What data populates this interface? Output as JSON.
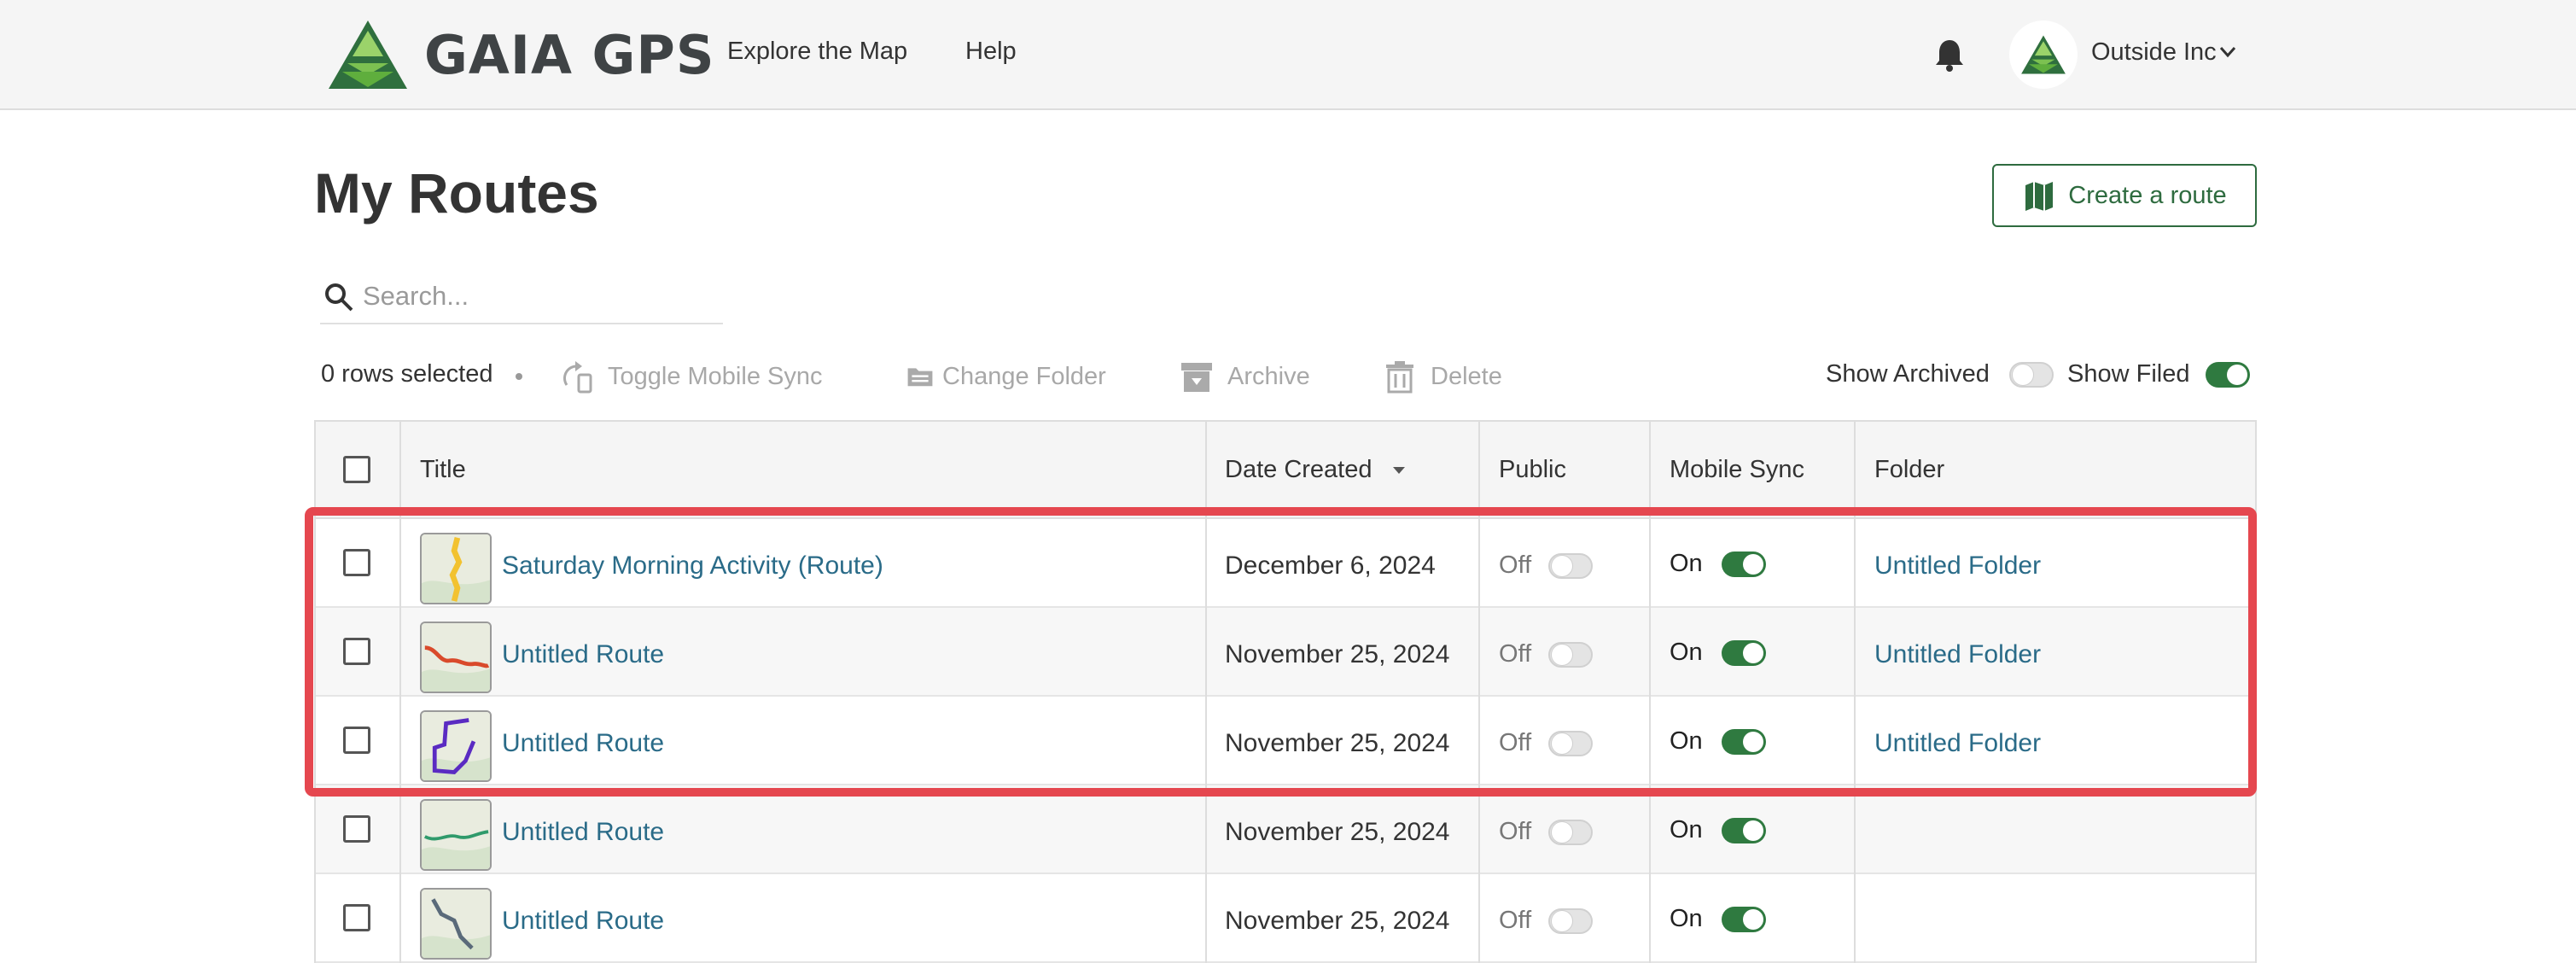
{
  "header": {
    "brand": "GAIA GPS",
    "nav": [
      "Explore the Map",
      "Help"
    ],
    "account": "Outside Inc",
    "icons": {
      "logo": "gaia-mountain-logo",
      "bell": "bell-icon",
      "chevron": "chevron-down-icon"
    }
  },
  "page": {
    "title": "My Routes",
    "create_button": "Create a route"
  },
  "search": {
    "placeholder": "Search...",
    "value": ""
  },
  "toolbar": {
    "rows_selected": "0 rows selected",
    "toggle_mobile_sync": "Toggle Mobile Sync",
    "change_folder": "Change Folder",
    "archive": "Archive",
    "delete": "Delete",
    "show_archived": "Show Archived",
    "show_archived_on": false,
    "show_filed": "Show Filed",
    "show_filed_on": true
  },
  "table": {
    "columns": [
      "Title",
      "Date Created",
      "Public",
      "Mobile Sync",
      "Folder"
    ],
    "sort": {
      "column": "Date Created",
      "direction": "desc"
    },
    "rows": [
      {
        "title": "Saturday Morning Activity (Route)",
        "date": "December 6, 2024",
        "public": "Off",
        "public_on": false,
        "sync": "On",
        "sync_on": true,
        "folder": "Untitled Folder",
        "route_color": "#f2c230"
      },
      {
        "title": "Untitled Route",
        "date": "November 25, 2024",
        "public": "Off",
        "public_on": false,
        "sync": "On",
        "sync_on": true,
        "folder": "Untitled Folder",
        "route_color": "#d94a2b"
      },
      {
        "title": "Untitled Route",
        "date": "November 25, 2024",
        "public": "Off",
        "public_on": false,
        "sync": "On",
        "sync_on": true,
        "folder": "Untitled Folder",
        "route_color": "#5a2bc2"
      },
      {
        "title": "Untitled Route",
        "date": "November 25, 2024",
        "public": "Off",
        "public_on": false,
        "sync": "On",
        "sync_on": true,
        "folder": "",
        "route_color": "#2f9a6b"
      },
      {
        "title": "Untitled Route",
        "date": "November 25, 2024",
        "public": "Off",
        "public_on": false,
        "sync": "On",
        "sync_on": true,
        "folder": "",
        "route_color": "#5a6a7a"
      }
    ]
  },
  "colors": {
    "accent": "#2e6b3f",
    "link": "#2a6b88",
    "highlight": "#e5474f"
  }
}
